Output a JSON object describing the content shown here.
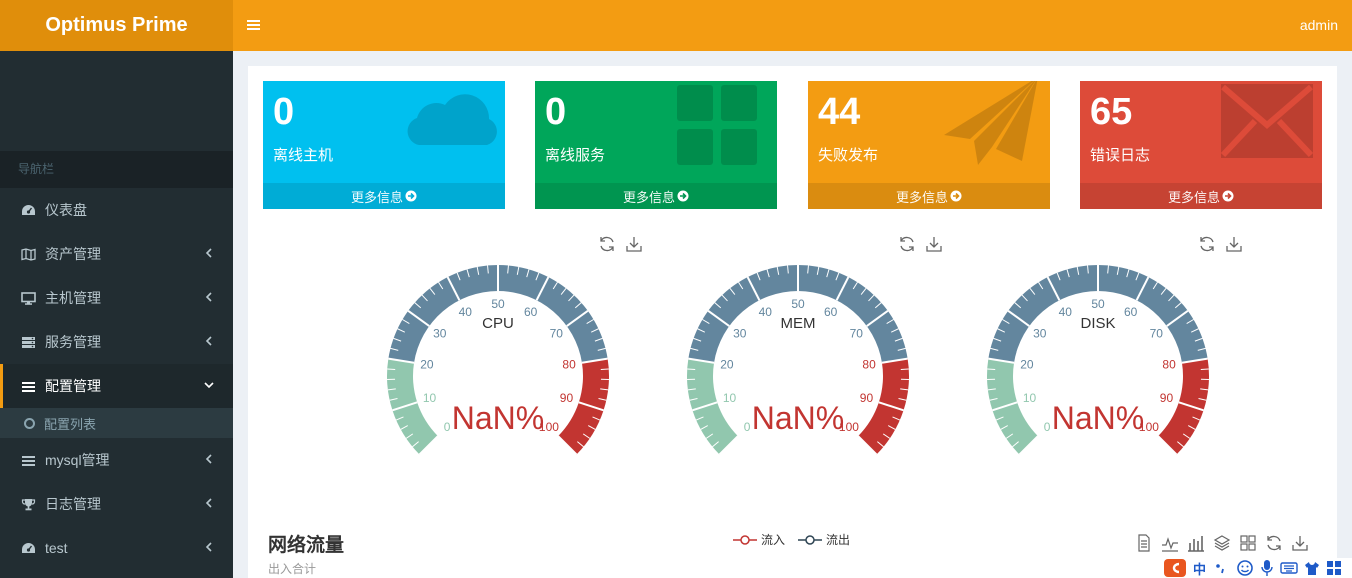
{
  "brand": "Optimus Prime",
  "user": "admin",
  "nav_header": "导航栏",
  "menu": [
    {
      "label": "仪表盘",
      "icon": "dashboard-icon",
      "has_arrow": false
    },
    {
      "label": "资产管理",
      "icon": "map-icon",
      "has_arrow": true
    },
    {
      "label": "主机管理",
      "icon": "desktop-icon",
      "has_arrow": true
    },
    {
      "label": "服务管理",
      "icon": "server-icon",
      "has_arrow": true
    },
    {
      "label": "配置管理",
      "icon": "list-icon",
      "has_arrow": true,
      "active": true
    },
    {
      "label": "mysql管理",
      "icon": "list-icon",
      "has_arrow": true
    },
    {
      "label": "日志管理",
      "icon": "trophy-icon",
      "has_arrow": true
    },
    {
      "label": "test",
      "icon": "dashboard-icon",
      "has_arrow": true
    }
  ],
  "submenu": [
    {
      "label": "配置列表"
    }
  ],
  "stat_boxes": [
    {
      "value": "0",
      "label": "离线主机",
      "footer": "更多信息",
      "color": "#00c0ef",
      "icon": "cloud-icon"
    },
    {
      "value": "0",
      "label": "离线服务",
      "footer": "更多信息",
      "color": "#00a65a",
      "icon": "grid-icon"
    },
    {
      "value": "44",
      "label": "失败发布",
      "footer": "更多信息",
      "color": "#f39c12",
      "icon": "paper-plane-icon"
    },
    {
      "value": "65",
      "label": "错误日志",
      "footer": "更多信息",
      "color": "#dd4b39",
      "icon": "envelope-icon"
    }
  ],
  "gauges": [
    {
      "name": "CPU",
      "value_text": "NaN%"
    },
    {
      "name": "MEM",
      "value_text": "NaN%"
    },
    {
      "name": "DISK",
      "value_text": "NaN%"
    }
  ],
  "gauge_ticks": [
    "0",
    "10",
    "20",
    "30",
    "40",
    "50",
    "60",
    "70",
    "80",
    "90",
    "100"
  ],
  "gauge_colors": {
    "low": "#91c7ae",
    "mid": "#63869e",
    "high": "#c23531"
  },
  "network": {
    "title": "网络流量",
    "subtitle": "出入合计",
    "legend": [
      {
        "label": "流入",
        "color": "#c23531"
      },
      {
        "label": "流出",
        "color": "#2f4554"
      }
    ]
  },
  "ime": {
    "text": "中"
  }
}
